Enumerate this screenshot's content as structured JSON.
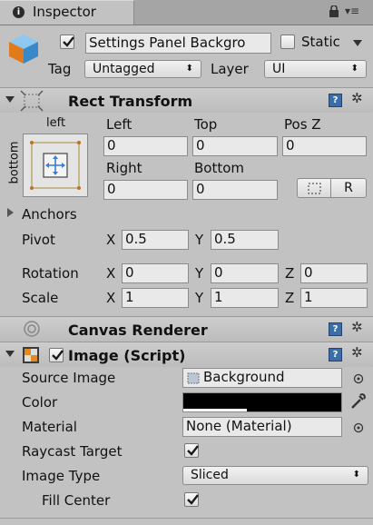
{
  "tab": {
    "title": "Inspector"
  },
  "object": {
    "name": "Settings Panel Backgro",
    "active": true,
    "static_label": "Static",
    "static_checked": false,
    "tag_label": "Tag",
    "tag_value": "Untagged",
    "layer_label": "Layer",
    "layer_value": "UI"
  },
  "rect_transform": {
    "title": "Rect Transform",
    "anchor_h": "left",
    "anchor_v": "bottom",
    "left_label": "Left",
    "top_label": "Top",
    "posz_label": "Pos Z",
    "left": "0",
    "top": "0",
    "posz": "0",
    "right_label": "Right",
    "bottom_label": "Bottom",
    "right": "0",
    "bottom": "0",
    "raw_button": "R",
    "anchors_label": "Anchors",
    "pivot_label": "Pivot",
    "pivot_x": "0.5",
    "pivot_y": "0.5",
    "rotation_label": "Rotation",
    "rot_x": "0",
    "rot_y": "0",
    "rot_z": "0",
    "scale_label": "Scale",
    "scale_x": "1",
    "scale_y": "1",
    "scale_z": "1",
    "axis_x": "X",
    "axis_y": "Y",
    "axis_z": "Z"
  },
  "canvas_renderer": {
    "title": "Canvas Renderer"
  },
  "image": {
    "title": "Image (Script)",
    "enabled": true,
    "source_label": "Source Image",
    "source_value": "Background",
    "color_label": "Color",
    "color_value": "#000000",
    "material_label": "Material",
    "material_value": "None (Material)",
    "raycast_label": "Raycast Target",
    "raycast_checked": true,
    "type_label": "Image Type",
    "type_value": "Sliced",
    "fill_label": "Fill Center",
    "fill_checked": true
  },
  "colors": {
    "background": "#c2c2c2",
    "field": "#e9e9e9",
    "help": "#3b6ea8",
    "anchor_blue": "#3a7bd5"
  }
}
